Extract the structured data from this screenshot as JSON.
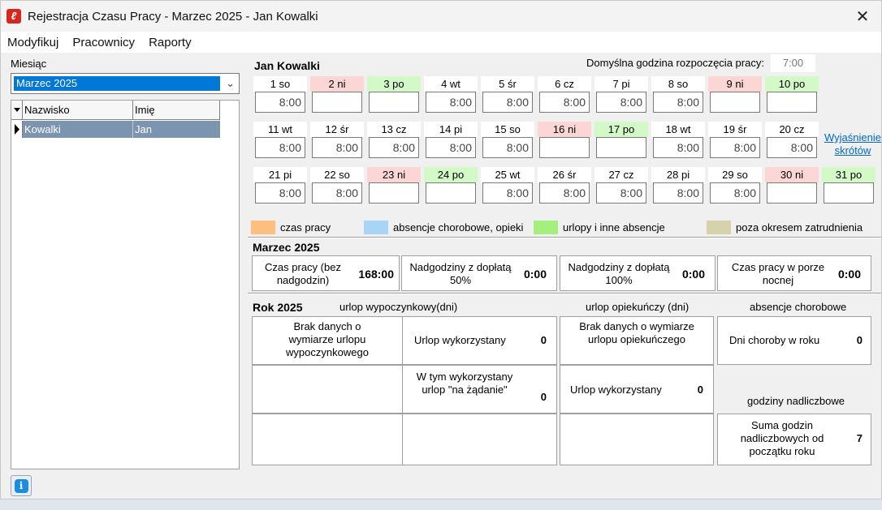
{
  "window": {
    "title": "Rejestracja Czasu Pracy - Marzec 2025 - Jan Kowalki",
    "close_glyph": "✕",
    "icon": "app-logo-icon"
  },
  "menu": [
    "Modyfikuj",
    "Pracownicy",
    "Raporty"
  ],
  "left": {
    "month_label": "Miesiąc",
    "month_value": "Marzec 2025",
    "grid_headers": [
      "Nazwisko",
      "Imię"
    ],
    "rows": [
      {
        "nazwisko": "Kowalki",
        "imie": "Jan"
      }
    ]
  },
  "employee": {
    "name": "Jan Kowalki",
    "default_start_label": "Domyślna godzina rozpoczęcia pracy:",
    "default_start_value": "7:00"
  },
  "days": [
    {
      "label": "1 so",
      "value": "8:00",
      "kind": "work"
    },
    {
      "label": "2 ni",
      "value": "",
      "kind": "sunday"
    },
    {
      "label": "3 po",
      "value": "",
      "kind": "leave"
    },
    {
      "label": "4 wt",
      "value": "8:00",
      "kind": "work"
    },
    {
      "label": "5 śr",
      "value": "8:00",
      "kind": "work"
    },
    {
      "label": "6 cz",
      "value": "8:00",
      "kind": "work"
    },
    {
      "label": "7 pi",
      "value": "8:00",
      "kind": "work"
    },
    {
      "label": "8 so",
      "value": "8:00",
      "kind": "work"
    },
    {
      "label": "9 ni",
      "value": "",
      "kind": "sunday"
    },
    {
      "label": "10 po",
      "value": "",
      "kind": "leave"
    },
    {
      "label": "11 wt",
      "value": "8:00",
      "kind": "work"
    },
    {
      "label": "12 śr",
      "value": "8:00",
      "kind": "work"
    },
    {
      "label": "13 cz",
      "value": "8:00",
      "kind": "work"
    },
    {
      "label": "14 pi",
      "value": "8:00",
      "kind": "work"
    },
    {
      "label": "15 so",
      "value": "8:00",
      "kind": "work"
    },
    {
      "label": "16 ni",
      "value": "",
      "kind": "sunday"
    },
    {
      "label": "17 po",
      "value": "",
      "kind": "leave"
    },
    {
      "label": "18 wt",
      "value": "8:00",
      "kind": "work"
    },
    {
      "label": "19 śr",
      "value": "8:00",
      "kind": "work"
    },
    {
      "label": "20 cz",
      "value": "8:00",
      "kind": "work"
    },
    {
      "label": "21 pi",
      "value": "8:00",
      "kind": "work"
    },
    {
      "label": "22 so",
      "value": "8:00",
      "kind": "work"
    },
    {
      "label": "23 ni",
      "value": "",
      "kind": "sunday"
    },
    {
      "label": "24 po",
      "value": "",
      "kind": "leave"
    },
    {
      "label": "25 wt",
      "value": "8:00",
      "kind": "work"
    },
    {
      "label": "26 śr",
      "value": "8:00",
      "kind": "work"
    },
    {
      "label": "27 cz",
      "value": "8:00",
      "kind": "work"
    },
    {
      "label": "28 pi",
      "value": "8:00",
      "kind": "work"
    },
    {
      "label": "29 so",
      "value": "8:00",
      "kind": "work"
    },
    {
      "label": "30 ni",
      "value": "",
      "kind": "sunday"
    },
    {
      "label": "31 po",
      "value": "",
      "kind": "leave"
    }
  ],
  "day_colors": {
    "work": "#ffffff",
    "sunday": "#fcd5d5",
    "leave": "#d3f9c6"
  },
  "explain_link": [
    "Wyjaśnienie",
    "skrótów"
  ],
  "legend": [
    {
      "label": "czas pracy",
      "color": "#fdbe7f"
    },
    {
      "label": "absencje chorobowe, opieki",
      "color": "#a8d4f8"
    },
    {
      "label": "urlopy i inne absencje",
      "color": "#a3f07f"
    },
    {
      "label": "poza okresem zatrudnienia",
      "color": "#d5d2ac"
    }
  ],
  "month_summary": {
    "title": "Marzec 2025",
    "items": [
      {
        "label": "Czas pracy (bez nadgodzin)",
        "value": "168:00"
      },
      {
        "label": "Nadgodziny z dopłatą 50%",
        "value": "0:00"
      },
      {
        "label": "Nadgodziny z dopłatą 100%",
        "value": "0:00"
      },
      {
        "label": "Czas pracy w porze nocnej",
        "value": "0:00"
      }
    ]
  },
  "year": {
    "title": "Rok 2025",
    "col_urlop": "urlop wypoczynkowy(dni)",
    "col_opieka": "urlop opiekuńczy (dni)",
    "col_chorobowe": "absencje chorobowe",
    "no_data_urlop": "Brak danych o wymiarze urlopu wypoczynkowego",
    "urlop_used_label": "Urlop wykorzystany",
    "urlop_used_value": "0",
    "na_zadanie_label": "W tym wykorzystany urlop \"na żądanie\"",
    "na_zadanie_value": "0",
    "no_data_opieka": "Brak danych o wymiarze urlopu opiekuńczego",
    "opieka_used_label": "Urlop wykorzystany",
    "opieka_used_value": "0",
    "sick_label": "Dni choroby w roku",
    "sick_value": "0",
    "overtime_header": "godziny nadliczbowe",
    "overtime_label": "Suma godzin nadliczbowych od początku roku",
    "overtime_value": "7"
  }
}
